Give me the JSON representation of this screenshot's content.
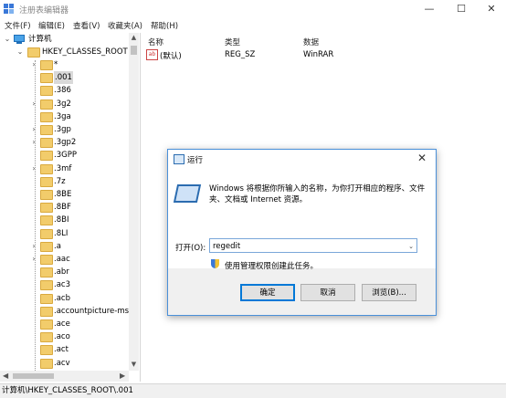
{
  "window": {
    "title": "注册表编辑器",
    "min_glyph": "—",
    "max_glyph": "☐",
    "close_glyph": "✕"
  },
  "menu": [
    "文件(F)",
    "编辑(E)",
    "查看(V)",
    "收藏夹(A)",
    "帮助(H)"
  ],
  "tree": {
    "root": "计算机",
    "hive": "HKEY_CLASSES_ROOT",
    "items": [
      {
        "label": "*",
        "expandable": true,
        "selected": false
      },
      {
        "label": ".001",
        "expandable": false,
        "selected": true
      },
      {
        "label": ".386",
        "expandable": false,
        "selected": false
      },
      {
        "label": ".3g2",
        "expandable": true,
        "selected": false
      },
      {
        "label": ".3ga",
        "expandable": false,
        "selected": false
      },
      {
        "label": ".3gp",
        "expandable": true,
        "selected": false
      },
      {
        "label": ".3gp2",
        "expandable": true,
        "selected": false
      },
      {
        "label": ".3GPP",
        "expandable": false,
        "selected": false
      },
      {
        "label": ".3mf",
        "expandable": true,
        "selected": false
      },
      {
        "label": ".7z",
        "expandable": false,
        "selected": false
      },
      {
        "label": ".8BE",
        "expandable": false,
        "selected": false
      },
      {
        "label": ".8BF",
        "expandable": false,
        "selected": false
      },
      {
        "label": ".8BI",
        "expandable": false,
        "selected": false
      },
      {
        "label": ".8LI",
        "expandable": false,
        "selected": false
      },
      {
        "label": ".a",
        "expandable": true,
        "selected": false
      },
      {
        "label": ".aac",
        "expandable": true,
        "selected": false
      },
      {
        "label": ".abr",
        "expandable": false,
        "selected": false
      },
      {
        "label": ".ac3",
        "expandable": false,
        "selected": false
      },
      {
        "label": ".acb",
        "expandable": false,
        "selected": false
      },
      {
        "label": ".accountpicture-ms",
        "expandable": false,
        "selected": false
      },
      {
        "label": ".ace",
        "expandable": false,
        "selected": false
      },
      {
        "label": ".aco",
        "expandable": false,
        "selected": false
      },
      {
        "label": ".act",
        "expandable": false,
        "selected": false
      },
      {
        "label": ".acv",
        "expandable": false,
        "selected": false
      }
    ]
  },
  "list": {
    "columns": [
      "名称",
      "类型",
      "数据"
    ],
    "rows": [
      {
        "icon": "ab",
        "name": "(默认)",
        "type": "REG_SZ",
        "data": "WinRAR"
      }
    ]
  },
  "statusbar": "计算机\\HKEY_CLASSES_ROOT\\.001",
  "run_dialog": {
    "title": "运行",
    "close_glyph": "✕",
    "description": "Windows 将根据你所输入的名称，为你打开相应的程序、文件夹、文档或 Internet 资源。",
    "open_label": "打开(O):",
    "input_value": "regedit",
    "admin_text": "使用管理权限创建此任务。",
    "ok_label": "确定",
    "cancel_label": "取消",
    "browse_label": "浏览(B)..."
  },
  "colors": {
    "accent": "#0078d7",
    "folder": "#f2cc6b",
    "selection": "#d9d9d9"
  }
}
